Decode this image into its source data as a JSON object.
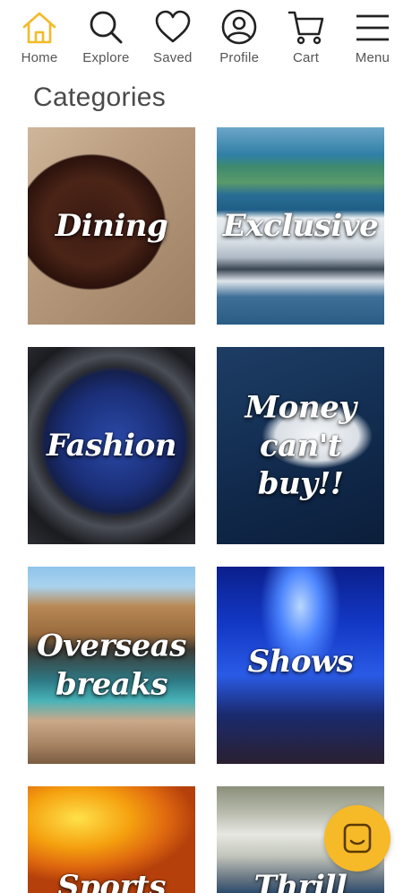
{
  "nav": {
    "items": [
      {
        "label": "Home",
        "icon": "home-icon"
      },
      {
        "label": "Explore",
        "icon": "search-icon"
      },
      {
        "label": "Saved",
        "icon": "heart-icon"
      },
      {
        "label": "Profile",
        "icon": "user-icon"
      },
      {
        "label": "Cart",
        "icon": "cart-icon"
      },
      {
        "label": "Menu",
        "icon": "menu-icon"
      }
    ],
    "active_color": "#f6b928",
    "icon_color": "#222222"
  },
  "page": {
    "heading": "Categories"
  },
  "categories": [
    {
      "label": "Dining"
    },
    {
      "label": "Exclusive"
    },
    {
      "label": "Fashion"
    },
    {
      "label": "Money can't buy!!"
    },
    {
      "label": "Overseas breaks"
    },
    {
      "label": "Shows"
    },
    {
      "label": "Sports"
    },
    {
      "label": "Thrill"
    }
  ],
  "chat": {
    "icon": "chat-icon",
    "color": "#f6b928"
  }
}
